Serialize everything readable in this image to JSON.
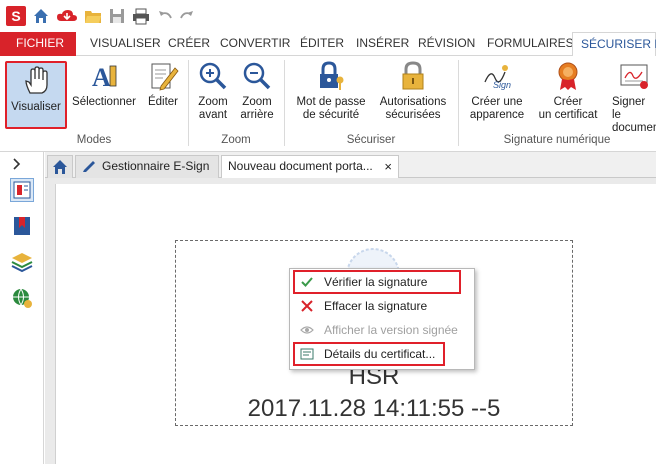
{
  "app": {
    "logo_letter": "S"
  },
  "ribbon_tabs": [
    "FICHIER",
    "VISUALISER",
    "CRÉER",
    "CONVERTIR",
    "ÉDITER",
    "INSÉRER",
    "RÉVISION",
    "FORMULAIRES",
    "SÉCURISER ET"
  ],
  "ribbon": {
    "modes": {
      "visualiser": "Visualiser",
      "selectionner": "Sélectionner",
      "editer": "Éditer",
      "group": "Modes"
    },
    "zoom": {
      "zoom_in_1": "Zoom",
      "zoom_in_2": "avant",
      "zoom_out_1": "Zoom",
      "zoom_out_2": "arrière",
      "group": "Zoom"
    },
    "securiser": {
      "password_1": "Mot de passe",
      "password_2": "de sécurité",
      "perm_1": "Autorisations",
      "perm_2": "sécurisées",
      "group": "Sécuriser"
    },
    "signature": {
      "create_appearance_1": "Créer une",
      "create_appearance_2": "apparence",
      "create_cert_1": "Créer",
      "create_cert_2": "un certificat",
      "sign_1": "Signer le",
      "sign_2": "documen",
      "group": "Signature numérique",
      "sign_icon_text": "Sign"
    }
  },
  "doc_tabs": {
    "tab1": "Gestionnaire E-Sign",
    "tab2": "Nouveau document porta...",
    "close": "×"
  },
  "signature_field": {
    "name": "HSR",
    "date": "2017.11.28 14:11:55 --5"
  },
  "context_menu": {
    "verify": "Vérifier la signature",
    "clear": "Effacer la signature",
    "show_signed": "Afficher la version signée",
    "cert_details": "Détails du certificat..."
  },
  "colors": {
    "brand_red": "#d8232a",
    "highlight_red": "#e0202a",
    "accent_blue": "#2b579a"
  }
}
